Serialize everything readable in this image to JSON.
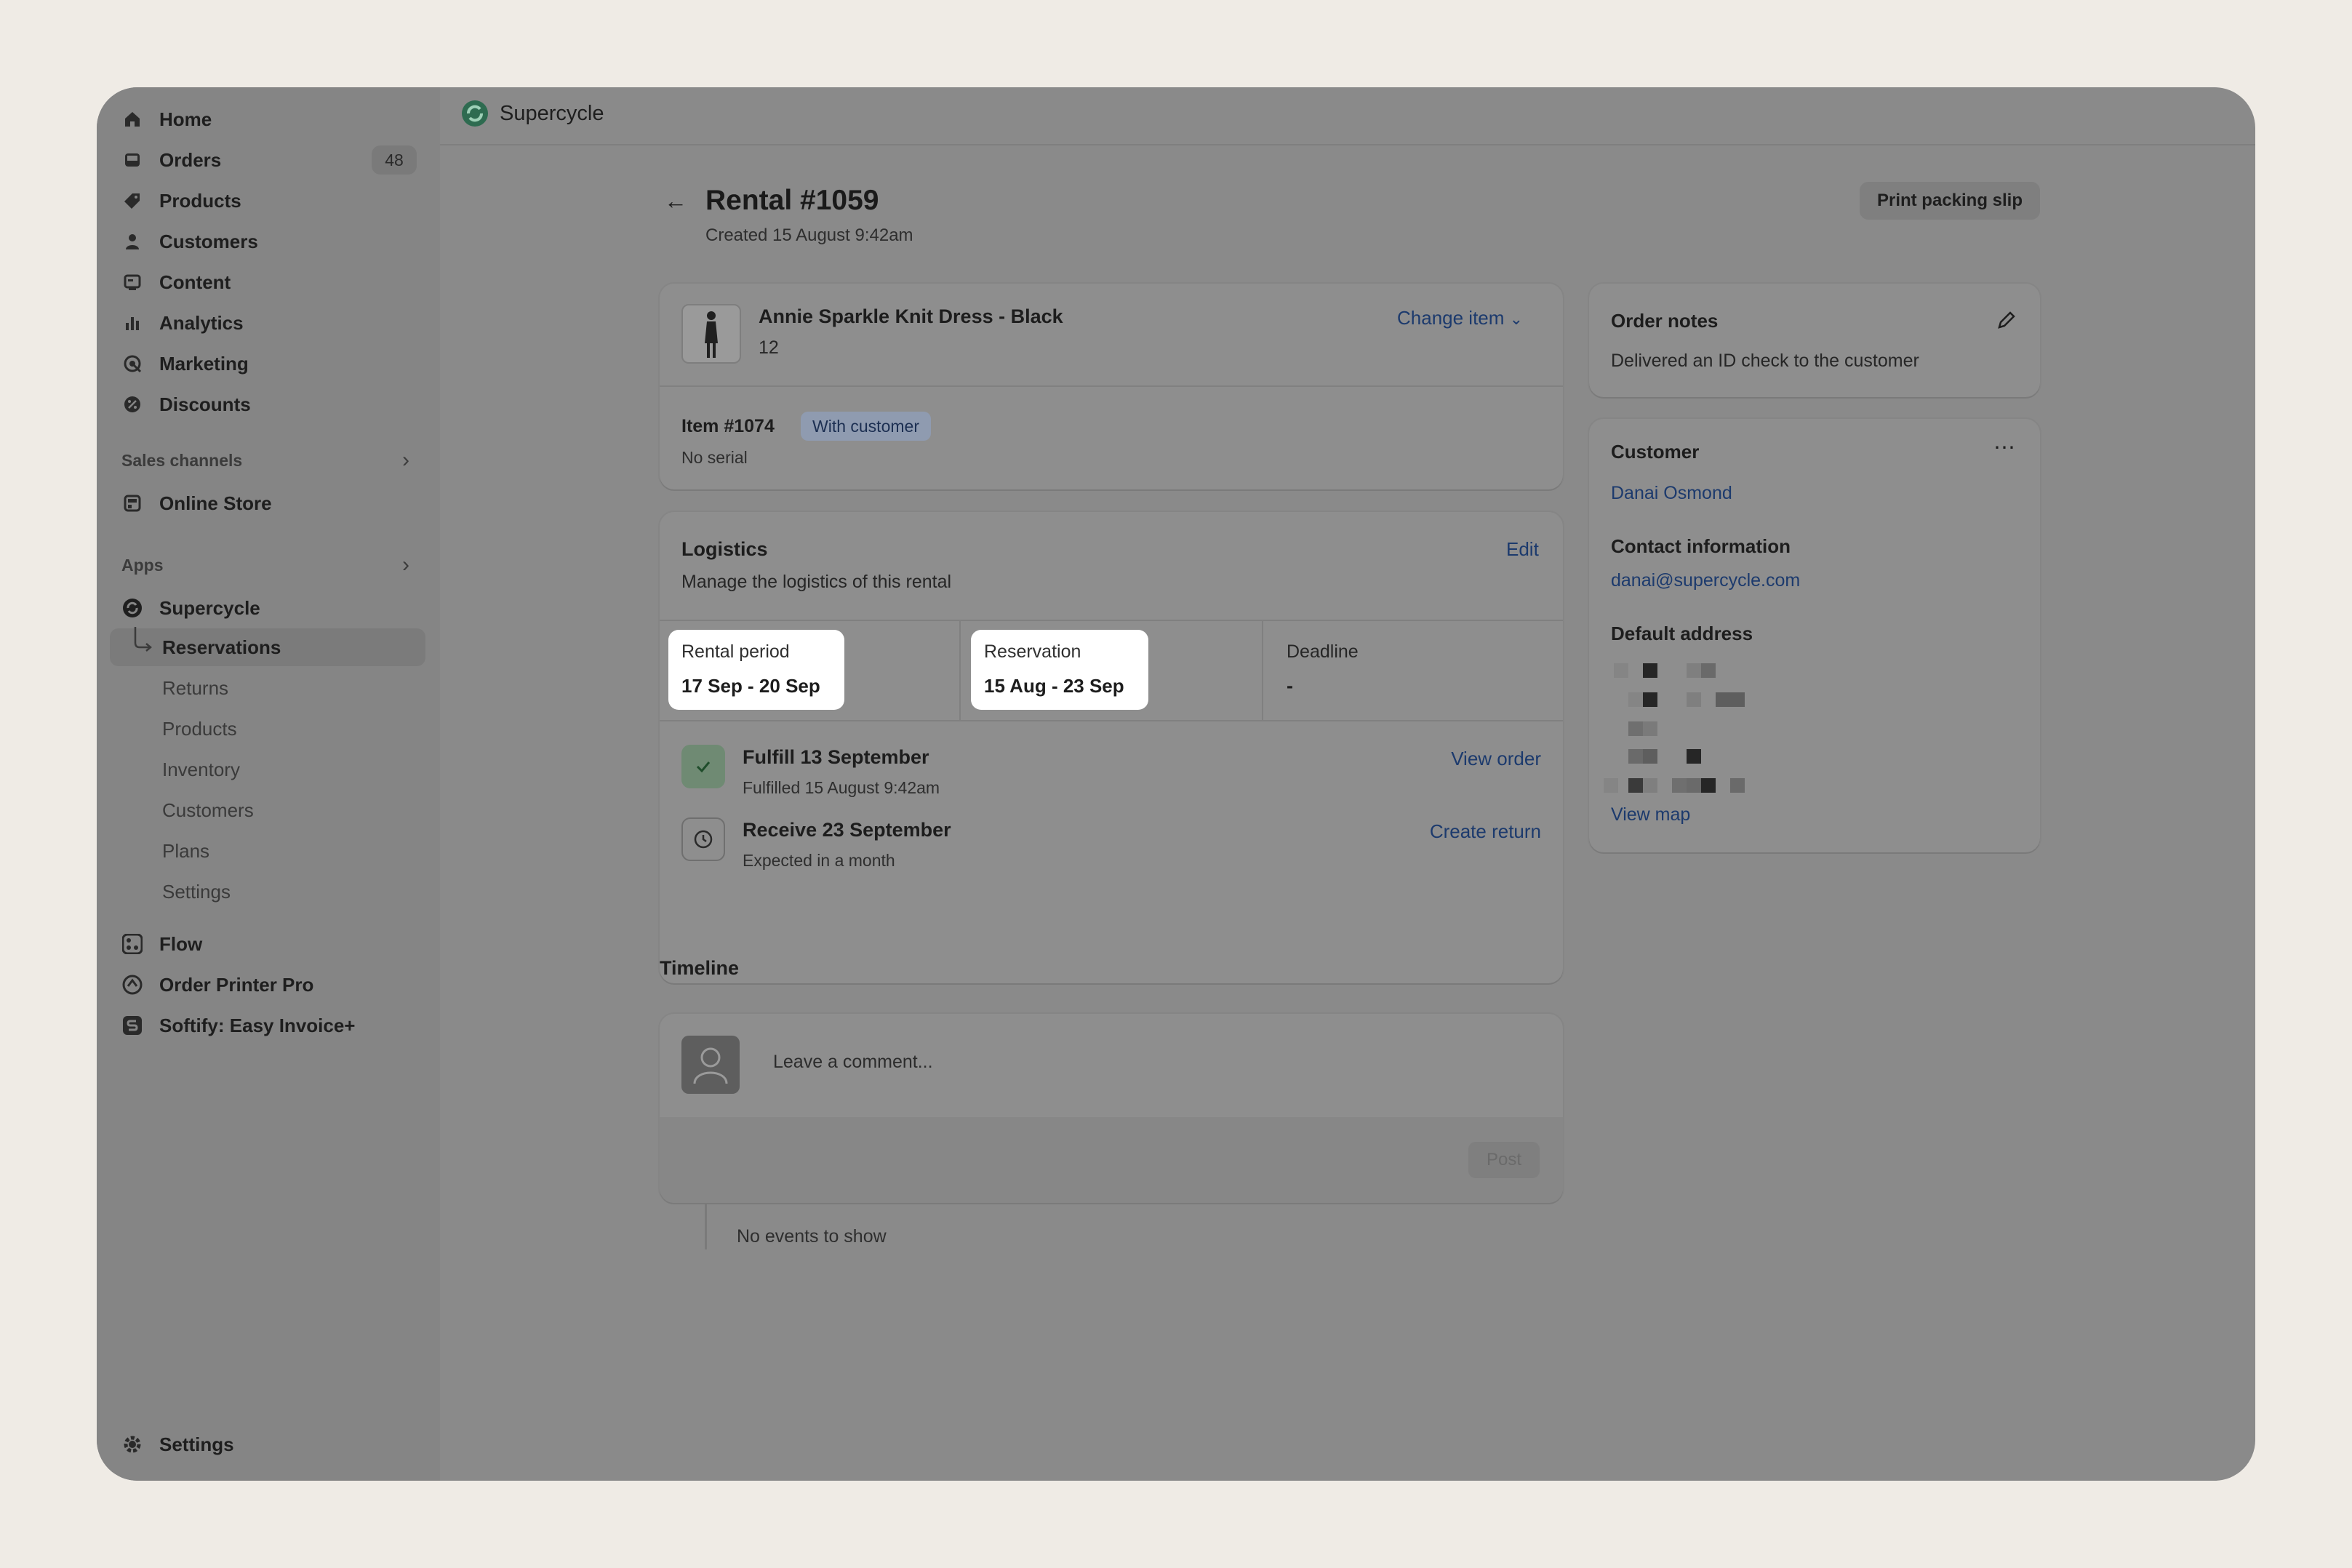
{
  "sidebar": {
    "items": [
      {
        "label": "Home",
        "icon": "home-icon"
      },
      {
        "label": "Orders",
        "icon": "inbox-icon",
        "badge": "48"
      },
      {
        "label": "Products",
        "icon": "tag-icon"
      },
      {
        "label": "Customers",
        "icon": "person-icon"
      },
      {
        "label": "Content",
        "icon": "content-icon"
      },
      {
        "label": "Analytics",
        "icon": "bar-chart-icon"
      },
      {
        "label": "Marketing",
        "icon": "target-icon"
      },
      {
        "label": "Discounts",
        "icon": "discount-icon"
      }
    ],
    "sales_channels_label": "Sales channels",
    "online_store": "Online Store",
    "apps_label": "Apps",
    "supercycle": "Supercycle",
    "sub_items": [
      "Reservations",
      "Returns",
      "Products",
      "Inventory",
      "Customers",
      "Plans",
      "Settings"
    ],
    "other_apps": [
      "Flow",
      "Order Printer Pro",
      "Softify: Easy Invoice+"
    ],
    "settings": "Settings"
  },
  "topbar": {
    "app_name": "Supercycle"
  },
  "page": {
    "title": "Rental #1059",
    "created": "Created 15 August 9:42am",
    "print_button": "Print packing slip"
  },
  "item_card": {
    "product_name": "Annie Sparkle Knit Dress - Black",
    "size": "12",
    "change_item": "Change item",
    "item_number": "Item #1074",
    "status_badge": "With customer",
    "serial": "No serial"
  },
  "logistics": {
    "title": "Logistics",
    "edit": "Edit",
    "description": "Manage the logistics of this rental",
    "rental_period_label": "Rental period",
    "rental_period_value": "17 Sep - 20 Sep",
    "reservation_label": "Reservation",
    "reservation_value": "15 Aug - 23 Sep",
    "deadline_label": "Deadline",
    "deadline_value": "-",
    "fulfill_title": "Fulfill 13 September",
    "fulfill_sub": "Fulfilled 15 August 9:42am",
    "view_order": "View order",
    "receive_title": "Receive 23 September",
    "receive_sub": "Expected in a month",
    "create_return": "Create return"
  },
  "timeline": {
    "title": "Timeline",
    "placeholder": "Leave a comment...",
    "post": "Post",
    "empty": "No events to show"
  },
  "order_notes": {
    "title": "Order notes",
    "text": "Delivered an ID check to the customer"
  },
  "customer": {
    "title": "Customer",
    "name": "Danai Osmond",
    "contact_title": "Contact information",
    "email": "danai@supercycle.com",
    "address_title": "Default address",
    "view_map": "View map"
  },
  "colors": {
    "overlay": "#8a8a8a",
    "page_bg": "#efebe5",
    "link": "#1c3a6d",
    "badge": "#8f9bb0",
    "highlight": "#ffffff"
  }
}
